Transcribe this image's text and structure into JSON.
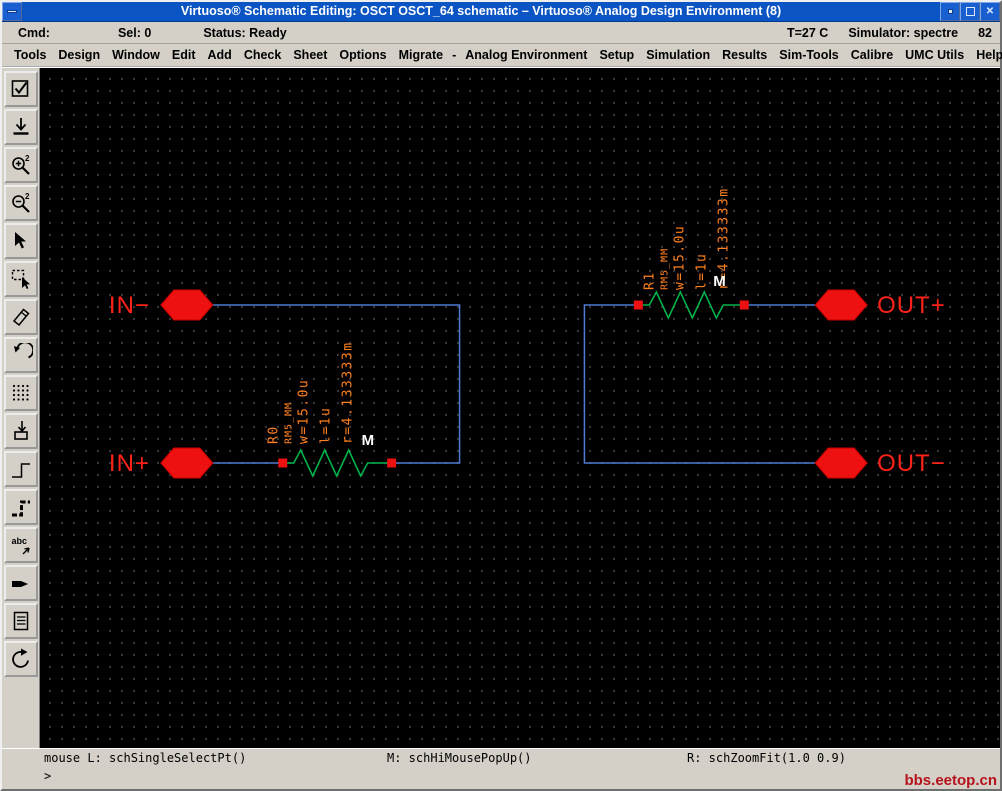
{
  "window": {
    "title": "Virtuoso® Schematic Editing: OSCT OSCT_64 schematic – Virtuoso® Analog Design Environment (8)"
  },
  "status_bar": {
    "cmd": "Cmd:",
    "sel": "Sel: 0",
    "status": "Status: Ready",
    "temp": "T=27 C",
    "simulator": "Simulator: spectre",
    "num": "82"
  },
  "menu": {
    "items": [
      "Tools",
      "Design",
      "Window",
      "Edit",
      "Add",
      "Check",
      "Sheet",
      "Options",
      "Migrate",
      "-",
      "Analog Environment",
      "Setup",
      "Simulation",
      "Results",
      "Sim-Tools",
      "Calibre",
      "UMC Utils"
    ],
    "help": "Help"
  },
  "toolbar": {
    "tools": [
      "check-and-save",
      "save",
      "zoom-in-2x",
      "zoom-out-2x",
      "stretch",
      "copy",
      "delete",
      "undo",
      "property",
      "instance",
      "wire-narrow",
      "wire-wide",
      "wire-name",
      "pin",
      "cmd-options",
      "redraw"
    ]
  },
  "schematic": {
    "pins": [
      {
        "label": "IN−"
      },
      {
        "label": "IN+"
      },
      {
        "label": "OUT+"
      },
      {
        "label": "OUT−"
      }
    ],
    "resistors": [
      {
        "name": "R0",
        "model": "RM5_MM",
        "width": "w=15.0u",
        "length": "l=1u",
        "resistance": "r=4.133333m",
        "mult": "M"
      },
      {
        "name": "R1",
        "model": "RM5_MM",
        "width": "w=15.0u",
        "length": "l=1u",
        "resistance": "r=4.133333m",
        "mult": "M"
      }
    ],
    "colors": {
      "wire": "#4f7bd0",
      "device": "#00b44c",
      "pin": "#ee1111",
      "property_label": "#ff8020",
      "pin_label": "#ff2218"
    }
  },
  "mouse_bindings": {
    "left": "mouse L: schSingleSelectPt()",
    "middle": "M: schHiMousePopUp()",
    "right": "R: schZoomFit(1.0 0.9)"
  },
  "prompt": ">",
  "watermark": "bbs.eetop.cn"
}
